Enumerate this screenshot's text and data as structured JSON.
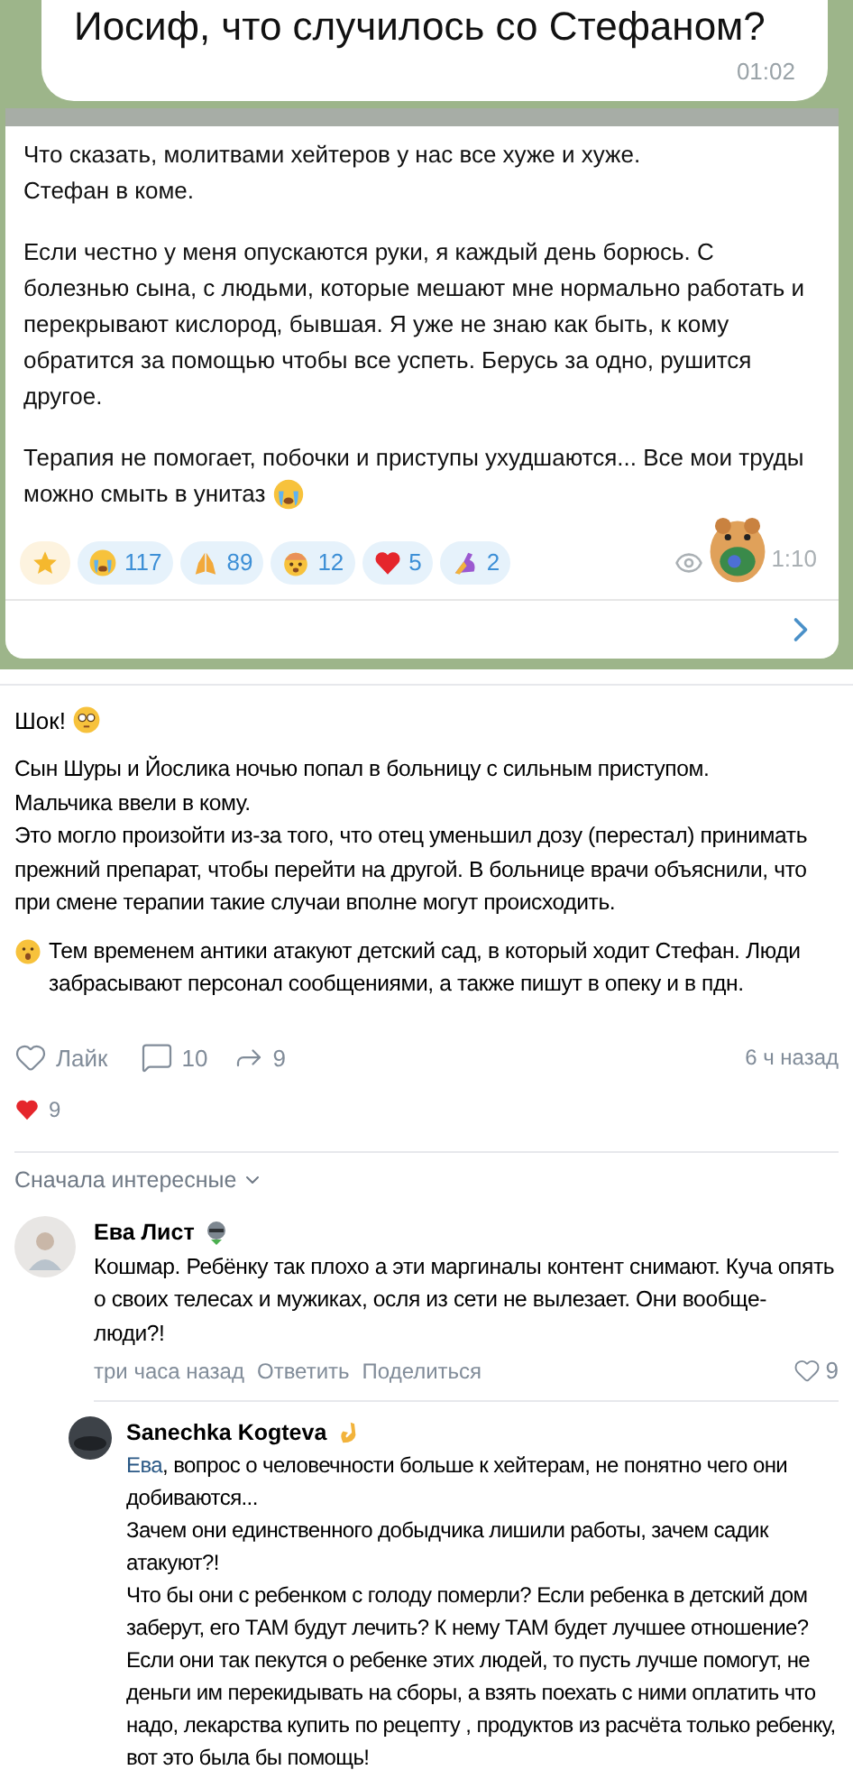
{
  "chat_screenshot": {
    "question": {
      "text": "Иосиф, что случилось со Стефаном?",
      "time": "01:02"
    },
    "reply": {
      "paragraphs": [
        "Что сказать, молитвами хейтеров у нас все хуже и хуже.\nСтефан в коме.",
        "Если честно у меня опускаются руки, я каждый день борюсь. С болезнью сына, с людьми, которые мешают мне нормально работать и перекрывают кислород, бывшая. Я уже не знаю как быть, к кому обратится за помощью чтобы все успеть. Берусь за одно, рушится другое.",
        "Терапия не помогает, побочки и приступы ухудшаются...  Все мои труды можно смыть в унитаз"
      ],
      "reactions": [
        {
          "kind": "star"
        },
        {
          "kind": "crying",
          "count": "117"
        },
        {
          "kind": "pray",
          "count": "89"
        },
        {
          "kind": "exploding",
          "count": "12"
        },
        {
          "kind": "heart",
          "count": "5"
        },
        {
          "kind": "muscle",
          "count": "2"
        }
      ],
      "time": "1:10"
    }
  },
  "post": {
    "title": "Шок!",
    "paragraphs": [
      "Сын Шуры и Йослика ночью попал в больницу с сильным приступом.\nМальчика ввели в кому.\nЭто могло произойти из-за того, что отец уменьшил дозу (перестал) принимать прежний препарат, чтобы перейти на другой. В больнице врачи объяснили, что при смене терапии такие случаи вполне могут происходить.",
      "Тем временем антики атакуют детский сад, в который ходит Стефан. Люди забрасывают персонал сообщениями, а также пишут в опеку и в пдн."
    ],
    "like_label": "Лайк",
    "comments": "10",
    "shares": "9",
    "time": "6 ч назад",
    "hearts": "9"
  },
  "sort": "Сначала интересные",
  "comments": [
    {
      "author": "Ева Лист",
      "text": "Кошмар. Ребёнку так плохо а эти маргиналы контент снимают. Куча опять о своих телесах и мужиках, осля из сети не вылезает. Они вообще- люди?!",
      "time": "три часа назад",
      "reply": "Ответить",
      "share": "Поделиться",
      "likes": "9",
      "children": [
        {
          "author": "Sanechka Kogteva",
          "mention": "Ева",
          "text": ", вопрос о человечности больше к хейтерам, не понятно чего они добиваются...\nЗачем они единственного добыдчика лишили работы, зачем садик атакуют?!\nЧто бы они с ребенком с голоду померли? Если ребенка в детский дом заберут, его ТАМ будут лечить? К нему ТАМ будет лучшее отношение? Если они так пекутся о ребенке этих людей, то пусть лучше помогут, не деньги им перекидывать на сборы, а взять поехать с ними оплатить что надо, лекарства купить по рецепту , продуктов из расчёта только ребенку, вот это была бы помощь!"
        }
      ]
    }
  ]
}
